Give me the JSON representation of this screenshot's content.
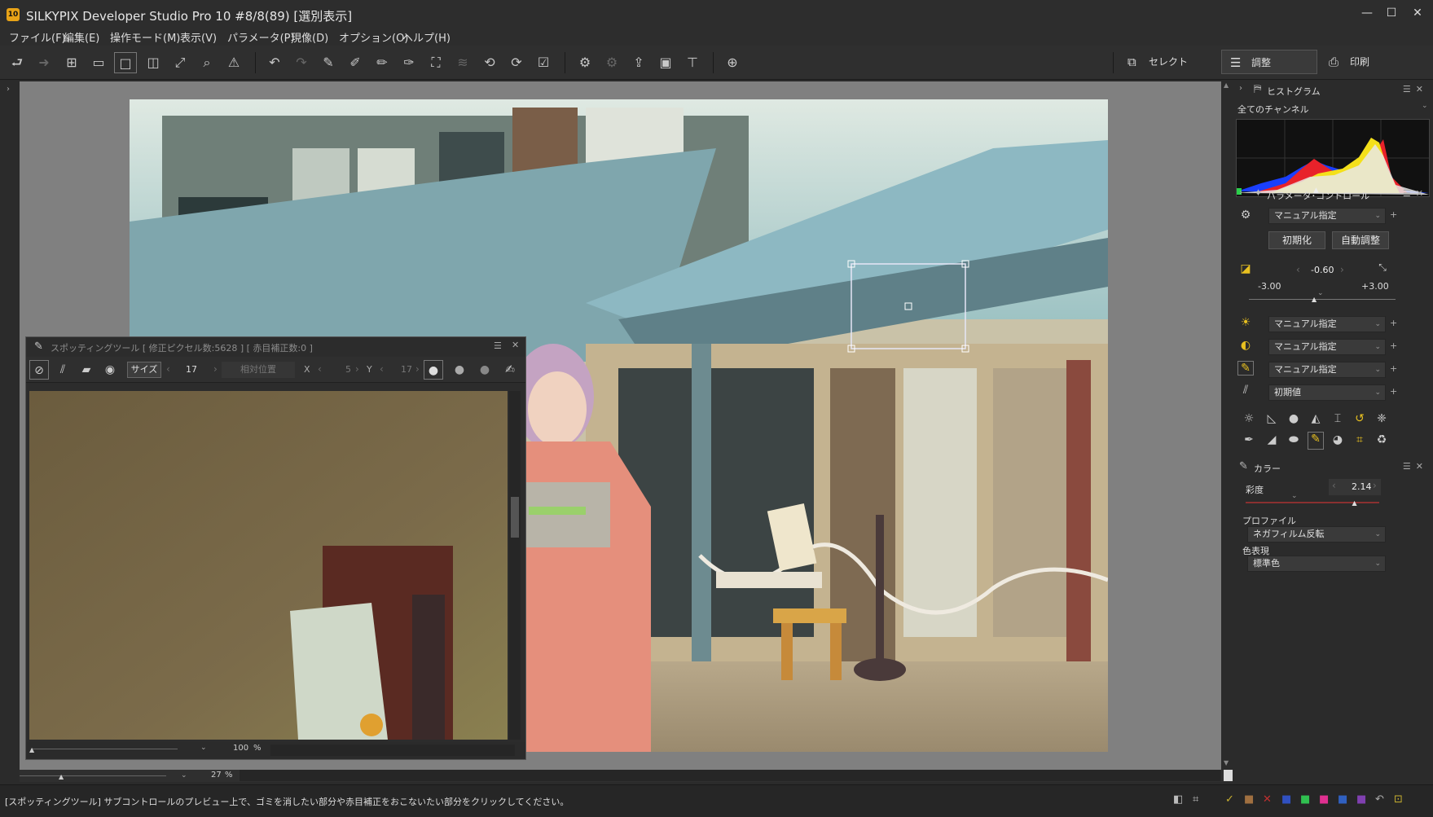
{
  "window": {
    "title": "SILKYPIX Developer Studio Pro 10   #8/8(89) [選別表示]",
    "app_icon": "10",
    "controls": [
      "—",
      "☐",
      "✕"
    ]
  },
  "menu": [
    "ファイル(F)",
    "編集(E)",
    "操作モード(M)",
    "表示(V)",
    "パラメータ(P)",
    "現像(D)",
    "オプション(O)",
    "ヘルプ(H)"
  ],
  "modes": {
    "select": "セレクト",
    "adjust": "調整",
    "print": "印刷"
  },
  "histogram": {
    "title": "ヒストグラム",
    "channel": "全てのチャンネル"
  },
  "param_control": {
    "title": "パラメータ･コントロール",
    "preset": "マニュアル指定",
    "reset_button": "初期化",
    "auto_button": "自動調整",
    "exposure_value": "-0.60",
    "exposure_min": "-3.00",
    "exposure_max": "+3.00",
    "exposure_position": 0.45,
    "wb_preset": "マニュアル指定",
    "contrast_preset": "マニュアル指定",
    "sharpness_preset": "マニュアル指定",
    "noise_preset": "初期値"
  },
  "color_panel": {
    "title": "カラー",
    "saturation_label": "彩度",
    "saturation_value": "2.14",
    "saturation_position": 0.82,
    "profile_label": "プロファイル",
    "profile_value": "ネガフィルム反転",
    "color_rendering_label": "色表現",
    "color_rendering_value": "標準色"
  },
  "spotting": {
    "title": "スポッティングツール [ 修正ピクセル数:5628 ] [ 赤目補正数:0 ]",
    "size_label": "サイズ",
    "size_value": "17",
    "relative_position": "相対位置",
    "x_label": "X",
    "x_value": "5",
    "y_label": "Y",
    "y_value": "17",
    "zoom_value": "100",
    "zoom_unit": "%"
  },
  "main_zoom": {
    "value": "27",
    "unit": "%"
  },
  "status_text": "[スポッティングツール] サブコントロールのプレビュー上で、ゴミを消したい部分や赤目補正をおこないたい部分をクリックしてください。"
}
